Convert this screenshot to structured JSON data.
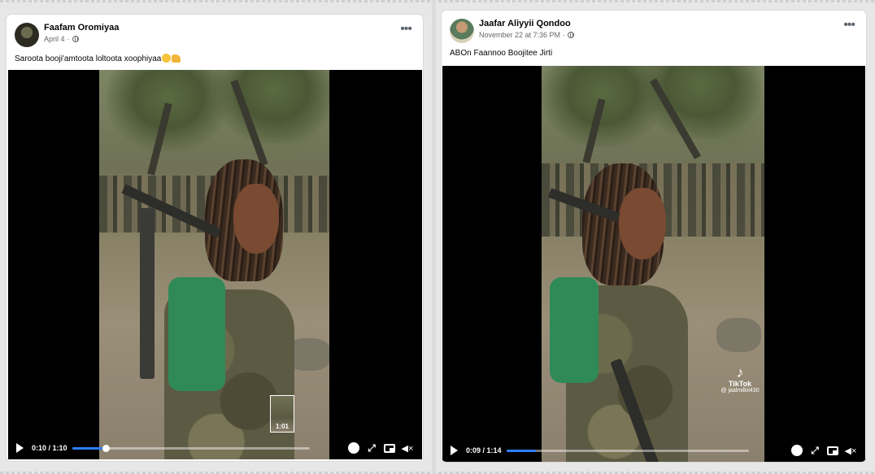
{
  "left_post": {
    "author": "Faafam Oromiyaa",
    "date": "April 4",
    "separator": "·",
    "caption": "Saroota booji'amtoota loltoota xoophiyaa",
    "video": {
      "time": "0:10 / 1:10",
      "progress": 0.143,
      "preview_time": "1:01"
    }
  },
  "right_post": {
    "author": "Jaafar Aliyyii Qondoo",
    "date": "November 22 at 7:36 PM",
    "separator": "·",
    "caption": "ABOn Faannoo Boojitee Jirti",
    "video": {
      "time": "0:09 / 1:14",
      "progress": 0.122,
      "watermark": {
        "label": "TikTok",
        "handle": "@ jaalmilkii430"
      }
    }
  },
  "icons": {
    "more": "more-options-icon",
    "globe": "globe-icon",
    "play": "play-icon",
    "settings": "gear-icon",
    "expand": "expand-icon",
    "pip": "picture-in-picture-icon",
    "volume": "volume-muted-icon",
    "tiktok": "tiktok-logo-icon"
  },
  "colors": {
    "progress_fill": "#2d7ff9",
    "backpack": "#2f8a58"
  }
}
